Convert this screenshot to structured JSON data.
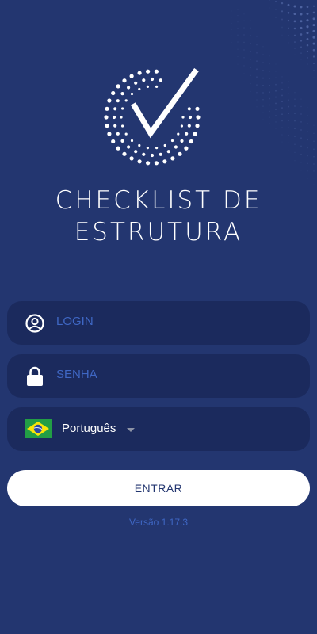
{
  "app": {
    "title_line1": "CHECKLIST DE",
    "title_line2": "ESTRUTURA"
  },
  "login": {
    "placeholder": "LOGIN",
    "value": ""
  },
  "password": {
    "placeholder": "SENHA",
    "value": ""
  },
  "language": {
    "selected": "Português",
    "flag_icon": "brazil-flag-icon"
  },
  "enter_button": {
    "label": "ENTRAR"
  },
  "version_text": "Versão 1.17.3",
  "colors": {
    "background": "#233670",
    "field_background": "#1b2a5d",
    "placeholder_text": "#3f67c4",
    "button_background": "#ffffff",
    "button_text": "#233670"
  }
}
